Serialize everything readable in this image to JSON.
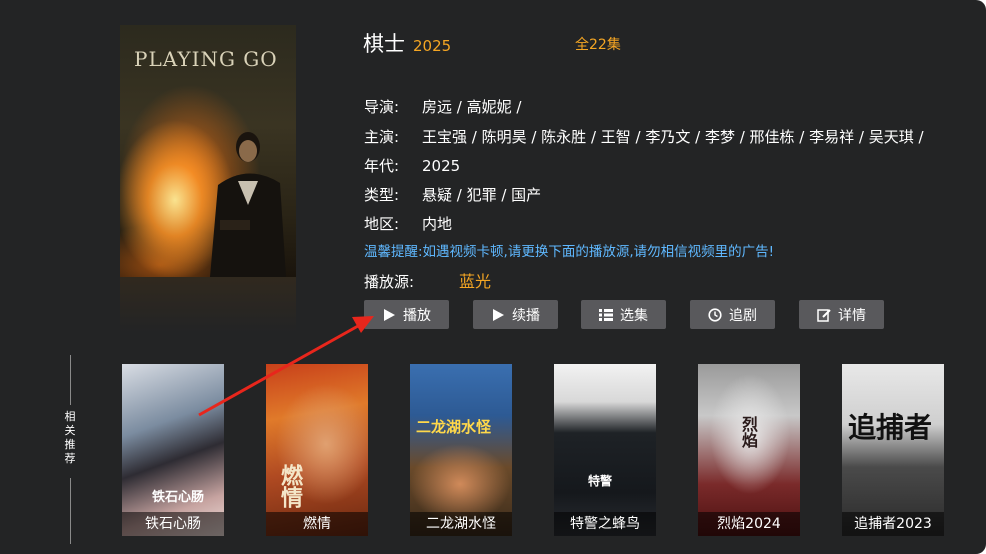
{
  "detail": {
    "poster_title": "PLAYING GO",
    "poster_title_cn": "棋士",
    "title": "棋士",
    "year": "2025",
    "episodes": "全22集",
    "director_label": "导演:",
    "director_value": "房远 / 高妮妮 /",
    "cast_label": "主演:",
    "cast_value": "王宝强 / 陈明昊 / 陈永胜 / 王智 / 李乃文 / 李梦 / 邢佳栋 / 李易祥 / 吴天琪 /",
    "year_label": "年代:",
    "year_value": "2025",
    "genre_label": "类型:",
    "genre_value": "悬疑 / 犯罪 / 国产",
    "region_label": "地区:",
    "region_value": "内地",
    "notice": "温馨提醒:如遇视频卡顿,请更换下面的播放源,请勿相信视频里的广告!",
    "source_label": "播放源:",
    "source_value": "蓝光"
  },
  "buttons": {
    "play": "播放",
    "resume": "续播",
    "episodes": "选集",
    "follow": "追剧",
    "details": "详情"
  },
  "related": {
    "label": "相关推荐",
    "items": [
      {
        "title": "铁石心肠",
        "art_text": "铁石心肠"
      },
      {
        "title": "燃情",
        "art_text": "燃情"
      },
      {
        "title": "二龙湖水怪",
        "art_text": "二龙湖水怪"
      },
      {
        "title": "特警之蜂鸟",
        "art_text": "特警"
      },
      {
        "title": "烈焰2024",
        "art_text": "烈焰"
      },
      {
        "title": "追捕者2023",
        "art_text": "追捕者"
      }
    ]
  },
  "colors": {
    "background": "#232425",
    "accent": "#f5a623",
    "notice": "#5fb8ff",
    "button": "#59595c",
    "arrow": "#e8261c"
  }
}
